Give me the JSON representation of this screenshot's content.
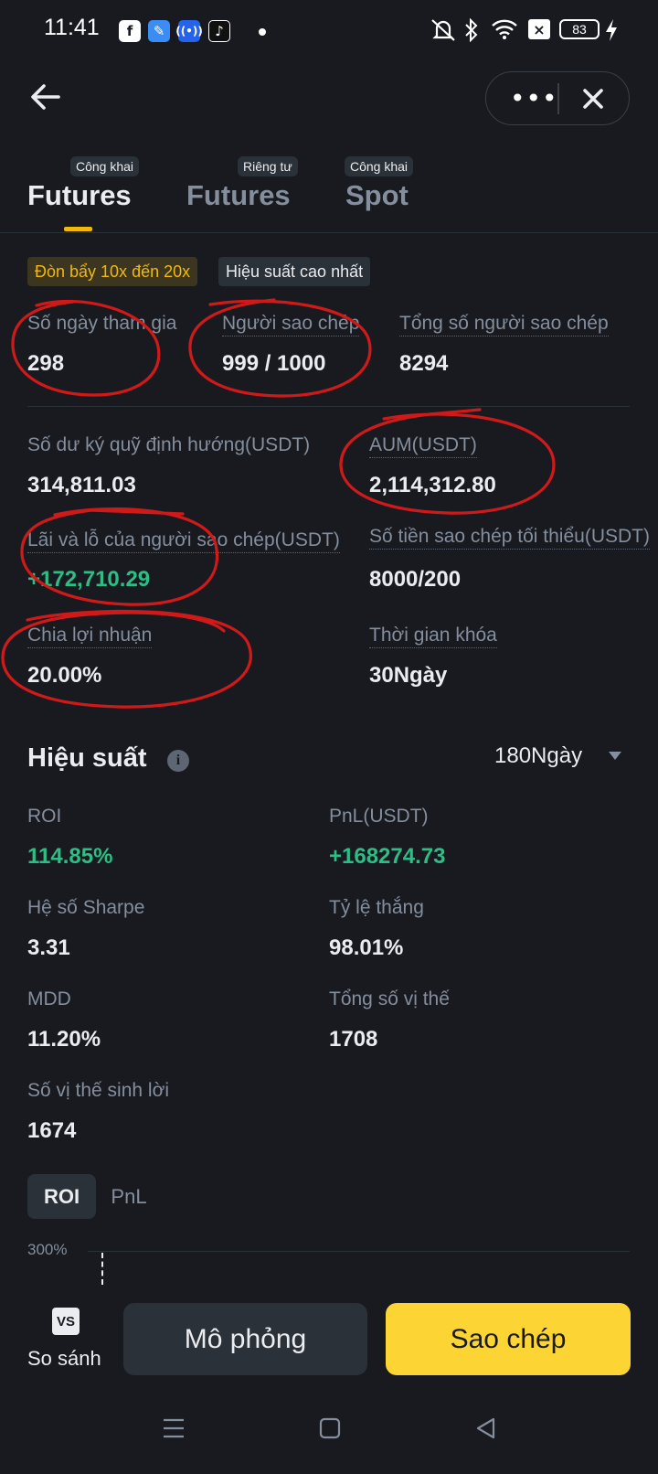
{
  "status_bar": {
    "time": "11:41",
    "battery": "83"
  },
  "header": {},
  "tabs": [
    {
      "badge": "Công khai",
      "label": "Futures"
    },
    {
      "badge": "Riêng tư",
      "label": "Futures"
    },
    {
      "badge": "Công khai",
      "label": "Spot"
    }
  ],
  "tags": [
    "Đòn bẩy 10x đến 20x",
    "Hiệu suất cao nhất"
  ],
  "stats_top": [
    {
      "label": "Số ngày tham gia",
      "value": "298"
    },
    {
      "label": "Người sao chép",
      "value": "999 / 1000"
    },
    {
      "label": "Tổng số người sao chép",
      "value": "8294"
    }
  ],
  "stats_grid": [
    {
      "label": "Số dư ký quỹ định hướng(USDT)",
      "value": "314,811.03"
    },
    {
      "label": "AUM(USDT)",
      "value": "2,114,312.80"
    },
    {
      "label": "Lãi và lỗ của người sao chép(USDT)",
      "value": "+172,710.29"
    },
    {
      "label": "Số tiền sao chép tối thiểu(USDT)",
      "value": "8000/200"
    },
    {
      "label": "Chia lợi nhuận",
      "value": "20.00%"
    },
    {
      "label": "Thời gian khóa",
      "value": "30Ngày"
    }
  ],
  "performance": {
    "title": "Hiệu suất",
    "period": "180Ngày",
    "metrics": [
      {
        "label": "ROI",
        "value": "114.85%"
      },
      {
        "label": "PnL(USDT)",
        "value": "+168274.73"
      },
      {
        "label": "Hệ số Sharpe",
        "value": "3.31"
      },
      {
        "label": "Tỷ lệ thắng",
        "value": "98.01%"
      },
      {
        "label": "MDD",
        "value": "11.20%"
      },
      {
        "label": "Tổng số vị thế",
        "value": "1708"
      },
      {
        "label": "Số vị thế sinh lời",
        "value": "1674"
      }
    ],
    "chart_tabs": [
      "ROI",
      "PnL"
    ],
    "chart_axis_top": "300%"
  },
  "bottom": {
    "vs_icon": "VS",
    "compare_label": "So sánh",
    "simulate_label": "Mô phỏng",
    "copy_label": "Sao chép"
  },
  "colors": {
    "accent": "#f0b90b",
    "positive": "#2ebd85",
    "annotation": "#d01a1a"
  }
}
